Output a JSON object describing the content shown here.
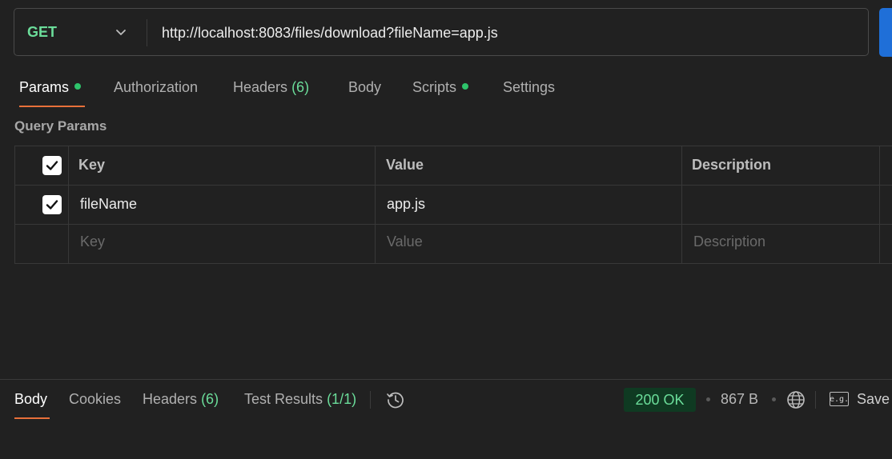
{
  "request": {
    "method": "GET",
    "url": "http://localhost:8083/files/download?fileName=app.js"
  },
  "request_tabs": {
    "params": "Params",
    "authorization": "Authorization",
    "headers": "Headers",
    "headers_count": "(6)",
    "body": "Body",
    "scripts": "Scripts",
    "settings": "Settings"
  },
  "query_params": {
    "title": "Query Params",
    "columns": {
      "key": "Key",
      "value": "Value",
      "description": "Description"
    },
    "rows": [
      {
        "checked": true,
        "key": "fileName",
        "value": "app.js",
        "description": ""
      }
    ],
    "placeholders": {
      "key": "Key",
      "value": "Value",
      "description": "Description"
    }
  },
  "response_tabs": {
    "body": "Body",
    "cookies": "Cookies",
    "headers": "Headers",
    "headers_count": "(6)",
    "test_results": "Test Results",
    "test_results_count": "(1/1)"
  },
  "response_meta": {
    "status": "200 OK",
    "size": "867 B",
    "example_label": "e.g.",
    "save_label": "Save"
  },
  "colors": {
    "accent_orange": "#e8703a",
    "success_green": "#6bdd9a",
    "send_blue": "#1f6fd8"
  },
  "icons": [
    "chevron-down-icon",
    "checkbox-checked-icon",
    "history-icon",
    "globe-icon",
    "example-icon"
  ]
}
